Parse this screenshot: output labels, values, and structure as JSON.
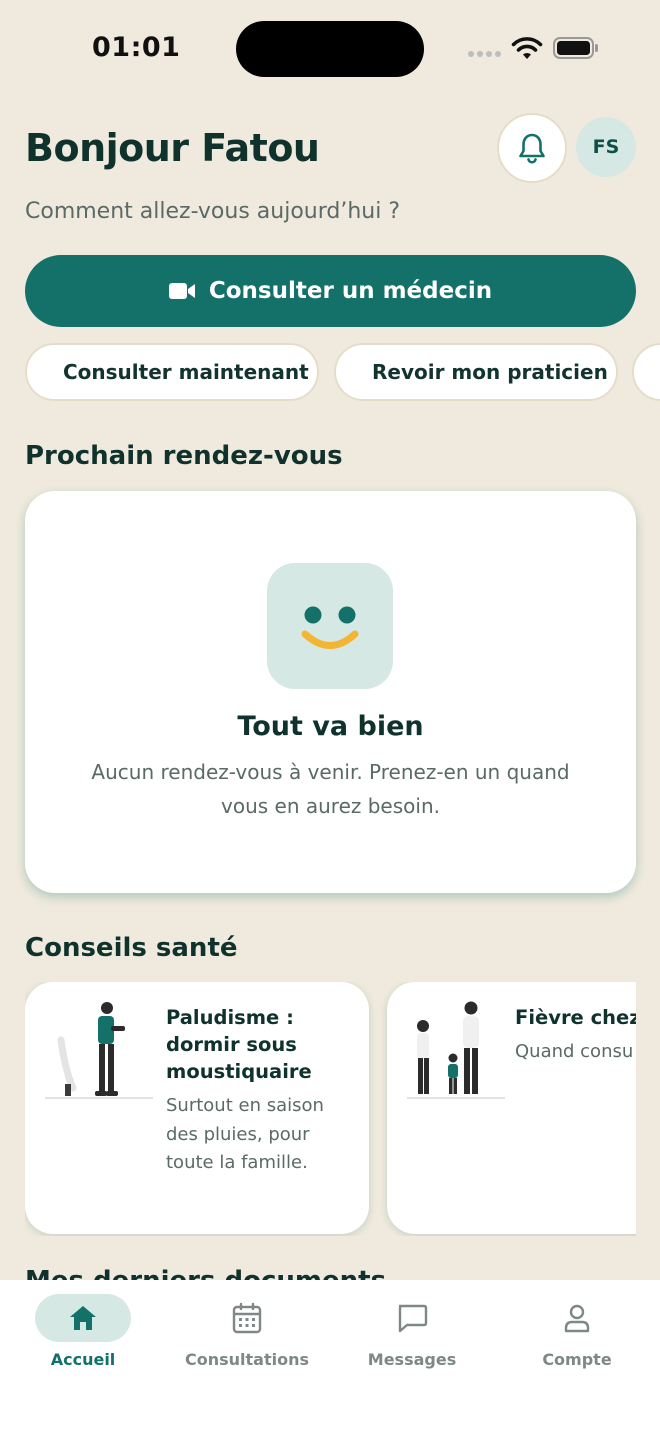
{
  "status_bar": {
    "time": "01:01"
  },
  "header": {
    "greeting": "Bonjour Fatou",
    "subtitle": "Comment allez-vous aujourd’hui ?",
    "avatar_initials": "FS"
  },
  "actions": {
    "primary_label": "Consulter un médecin",
    "chips": [
      {
        "label": "Consulter maintenant",
        "icon": "bolt-icon"
      },
      {
        "label": "Revoir mon praticien",
        "icon": "history-icon"
      }
    ]
  },
  "appointments": {
    "section_title": "Prochain rendez-vous",
    "empty_title": "Tout va bien",
    "empty_text": "Aucun rendez-vous à venir. Prenez-en un quand vous en aurez besoin."
  },
  "tips": {
    "section_title": "Conseils santé",
    "items": [
      {
        "title": "Paludisme : dormir sous moustiquaire",
        "text": "Surtout en saison des pluies, pour toute la famille."
      },
      {
        "title": "Fièvre chez l",
        "text": "Quand consu sans attendre"
      }
    ]
  },
  "next_section_title": "Mes derniers documents",
  "nav": {
    "items": [
      {
        "label": "Accueil",
        "icon": "home-icon",
        "active": true
      },
      {
        "label": "Consultations",
        "icon": "calendar-icon",
        "active": false
      },
      {
        "label": "Messages",
        "icon": "message-icon",
        "active": false
      },
      {
        "label": "Compte",
        "icon": "user-icon",
        "active": false
      }
    ]
  },
  "colors": {
    "background": "#efeadd",
    "primary": "#13716a",
    "accent_light": "#d5e8e4",
    "smile_yellow": "#f2b632",
    "text_dark": "#0f322d"
  }
}
